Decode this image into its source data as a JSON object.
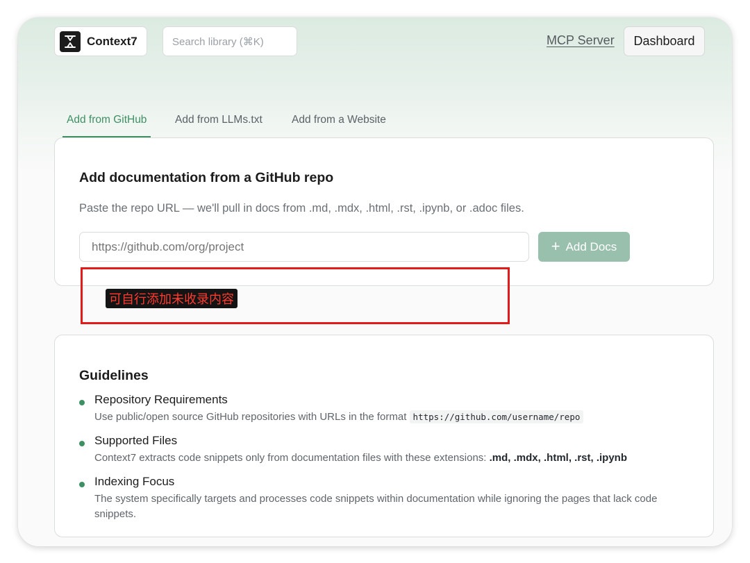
{
  "header": {
    "brand": "Context7",
    "search_placeholder": "Search library (⌘K)",
    "mcp_link": "MCP Server",
    "dashboard_label": "Dashboard"
  },
  "tabs": [
    {
      "label": "Add from GitHub",
      "active": true
    },
    {
      "label": "Add from LLMs.txt",
      "active": false
    },
    {
      "label": "Add from a Website",
      "active": false
    }
  ],
  "add_card": {
    "title": "Add documentation from a GitHub repo",
    "description": "Paste the repo URL — we'll pull in docs from .md, .mdx, .html, .rst, .ipynb, or .adoc files.",
    "input_placeholder": "https://github.com/org/project",
    "button_label": "Add Docs",
    "button_icon": "plus-icon"
  },
  "annotation": {
    "text": "可自行添加未收录内容",
    "box_color": "#e21a1a"
  },
  "guidelines": {
    "title": "Guidelines",
    "items": [
      {
        "heading": "Repository Requirements",
        "text": "Use public/open source GitHub repositories with URLs in the format",
        "code": "https://github.com/username/repo"
      },
      {
        "heading": "Supported Files",
        "text": "Context7 extracts code snippets only from documentation files with these extensions:",
        "extensions": ".md, .mdx, .html, .rst, .ipynb"
      },
      {
        "heading": "Indexing Focus",
        "text": "The system specifically targets and processes code snippets within documentation while ignoring the pages that lack code snippets."
      }
    ]
  },
  "colors": {
    "accent": "#3e8f63",
    "button_bg": "#98c0ad"
  }
}
